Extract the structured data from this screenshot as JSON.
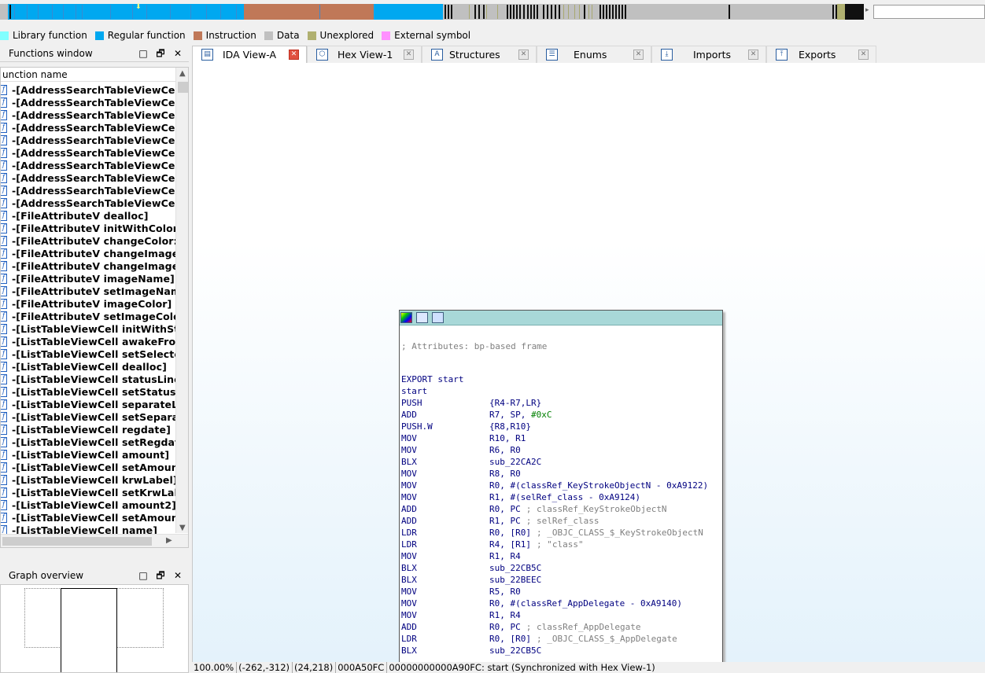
{
  "colors": {
    "library_function": "#80ffff",
    "regular_function": "#00a8f0",
    "instruction": "#c07858",
    "data": "#c0c0c0",
    "unexplored": "#b0b070",
    "external_symbol": "#ff90ff"
  },
  "legend": [
    {
      "label": "Library function",
      "color": "#80ffff"
    },
    {
      "label": "Regular function",
      "color": "#00a8f0"
    },
    {
      "label": "Instruction",
      "color": "#c07858"
    },
    {
      "label": "Data",
      "color": "#c0c0c0"
    },
    {
      "label": "Unexplored",
      "color": "#b0b070"
    },
    {
      "label": "External symbol",
      "color": "#ff90ff"
    }
  ],
  "functions_window": {
    "title": "Functions window",
    "column_header": "unction name",
    "items": [
      "-[AddressSearchTableViewCell",
      "-[AddressSearchTableViewCell",
      "-[AddressSearchTableViewCell",
      "-[AddressSearchTableViewCell",
      "-[AddressSearchTableViewCell",
      "-[AddressSearchTableViewCell",
      "-[AddressSearchTableViewCell",
      "-[AddressSearchTableViewCell",
      "-[AddressSearchTableViewCell",
      "-[AddressSearchTableViewCell",
      "-[FileAttributeV dealloc]",
      "-[FileAttributeV initWithColor:im",
      "-[FileAttributeV changeColor:]",
      "-[FileAttributeV changeImage:]",
      "-[FileAttributeV changeImage:w",
      "-[FileAttributeV imageName]",
      "-[FileAttributeV setImageName:",
      "-[FileAttributeV imageColor]",
      "-[FileAttributeV setImageColor:",
      "-[ListTableViewCell initWithSty",
      "-[ListTableViewCell awakeFron",
      "-[ListTableViewCell setSelecte",
      "-[ListTableViewCell dealloc]",
      "-[ListTableViewCell statusLine",
      "-[ListTableViewCell setStatusL",
      "-[ListTableViewCell separateLi",
      "-[ListTableViewCell setSeparat",
      "-[ListTableViewCell regdate]",
      "-[ListTableViewCell setRegdate",
      "-[ListTableViewCell amount]",
      "-[ListTableViewCell setAmount",
      "-[ListTableViewCell krwLabel]",
      "-[ListTableViewCell setKrwLab",
      "-[ListTableViewCell amount2]",
      "-[ListTableViewCell setAmount",
      "-[ListTableViewCell name]"
    ]
  },
  "graph_overview": {
    "title": "Graph overview"
  },
  "tabs": [
    {
      "label": "IDA View-A",
      "icon": "ida-view-icon",
      "active": true
    },
    {
      "label": "Hex View-1",
      "icon": "hex-view-icon",
      "active": false
    },
    {
      "label": "Structures",
      "icon": "structures-icon",
      "active": false
    },
    {
      "label": "Enums",
      "icon": "enums-icon",
      "active": false
    },
    {
      "label": "Imports",
      "icon": "imports-icon",
      "active": false
    },
    {
      "label": "Exports",
      "icon": "exports-icon",
      "active": false
    }
  ],
  "code": {
    "comment": "; Attributes: bp-based frame",
    "export_line": "EXPORT start",
    "label": "start",
    "lines": [
      {
        "mn": "PUSH",
        "op": "{R4-R7,LR}"
      },
      {
        "mn": "ADD",
        "op": "R7, SP, ",
        "num": "#0xC"
      },
      {
        "mn": "PUSH.W",
        "op": "{R8,R10}"
      },
      {
        "mn": "MOV",
        "op": "R10, R1"
      },
      {
        "mn": "MOV",
        "op": "R6, R0"
      },
      {
        "mn": "BLX",
        "op": "sub_22CA2C"
      },
      {
        "mn": "MOV",
        "op": "R8, R0"
      },
      {
        "mn": "MOV",
        "op": "R0, #(classRef_KeyStrokeObjectN - 0xA9122)"
      },
      {
        "mn": "MOV",
        "op": "R1, #(selRef_class - 0xA9124)"
      },
      {
        "mn": "ADD",
        "op": "R0, PC",
        "cmt": "; classRef_KeyStrokeObjectN"
      },
      {
        "mn": "ADD",
        "op": "R1, PC",
        "cmt": "; selRef_class"
      },
      {
        "mn": "LDR",
        "op": "R0, [R0]",
        "cmt": "; _OBJC_CLASS_$_KeyStrokeObjectN"
      },
      {
        "mn": "LDR",
        "op": "R4, [R1]",
        "cmt": "; \"class\""
      },
      {
        "mn": "MOV",
        "op": "R1, R4"
      },
      {
        "mn": "BLX",
        "op": "sub_22CB5C"
      },
      {
        "mn": "BLX",
        "op": "sub_22BEEC"
      },
      {
        "mn": "MOV",
        "op": "R5, R0"
      },
      {
        "mn": "MOV",
        "op": "R0, #(classRef_AppDelegate - 0xA9140)"
      },
      {
        "mn": "MOV",
        "op": "R1, R4"
      },
      {
        "mn": "ADD",
        "op": "R0, PC",
        "cmt": "; classRef_AppDelegate"
      },
      {
        "mn": "LDR",
        "op": "R0, [R0]",
        "cmt": "; _OBJC_CLASS_$_AppDelegate"
      },
      {
        "mn": "BLX",
        "op": "sub_22CB5C"
      }
    ]
  },
  "status": {
    "zoom": "100.00%",
    "coords": "(-262,-312)",
    "mouse": "(24,218)",
    "offset": "000A50FC",
    "address": "00000000000A90FC: start (Synchronized with Hex View-1)"
  }
}
